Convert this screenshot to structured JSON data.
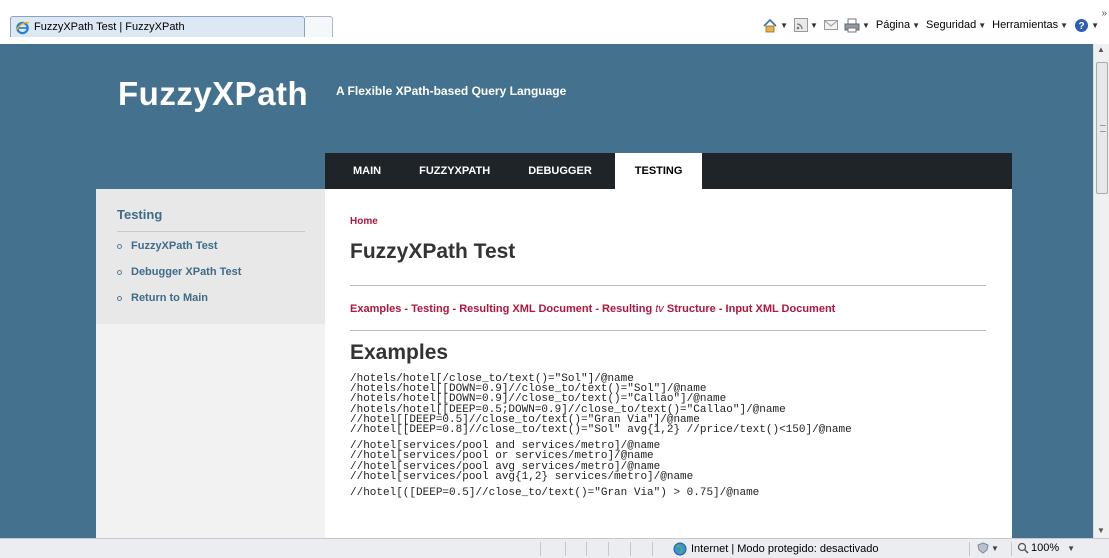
{
  "browser": {
    "tab_title": "FuzzyXPath Test | FuzzyXPath",
    "commands": {
      "page": "Página",
      "security": "Seguridad",
      "tools": "Herramientas"
    }
  },
  "site": {
    "logo": "FuzzyXPath",
    "tagline": "A Flexible XPath-based Query Language"
  },
  "nav": {
    "items": [
      "MAIN",
      "FUZZYXPATH",
      "DEBUGGER",
      "TESTING"
    ],
    "active": "TESTING"
  },
  "sidebar": {
    "title": "Testing",
    "links": [
      "FuzzyXPath Test",
      "Debugger XPath Test",
      "Return to Main"
    ]
  },
  "content": {
    "breadcrumb": "Home",
    "title": "FuzzyXPath Test",
    "toc": {
      "item1": "Examples",
      "item2": "Testing",
      "item3": "Resulting XML Document",
      "item4_prefix": "Resulting",
      "item4_symbol": "tv",
      "item4_suffix": "Structure",
      "item5": "Input XML Document",
      "separator": " - "
    },
    "section_title": "Examples",
    "code_block1": "/hotels/hotel[/close_to/text()=\"Sol\"]/@name\n/hotels/hotel[[DOWN=0.9]//close_to/text()=\"Sol\"]/@name\n/hotels/hotel[[DOWN=0.9]//close_to/text()=\"Callao\"]/@name\n/hotels/hotel[[DEEP=0.5;DOWN=0.9]//close_to/text()=\"Callao\"]/@name\n//hotel[[DEEP=0.5]//close_to/text()=\"Gran Via\"]/@name\n//hotel[[DEEP=0.8]//close_to/text()=\"Sol\" avg{1,2} //price/text()<150]/@name",
    "code_block2": "//hotel[services/pool and services/metro]/@name\n//hotel[services/pool or services/metro]/@name\n//hotel[services/pool avg services/metro]/@name\n//hotel[services/pool avg{1,2} services/metro]/@name",
    "code_block3": "//hotel[([DEEP=0.5]//close_to/text()=\"Gran Via\") > 0.75]/@name"
  },
  "statusbar": {
    "zone": "Internet | Modo protegido: desactivado",
    "zoom": "100%"
  }
}
